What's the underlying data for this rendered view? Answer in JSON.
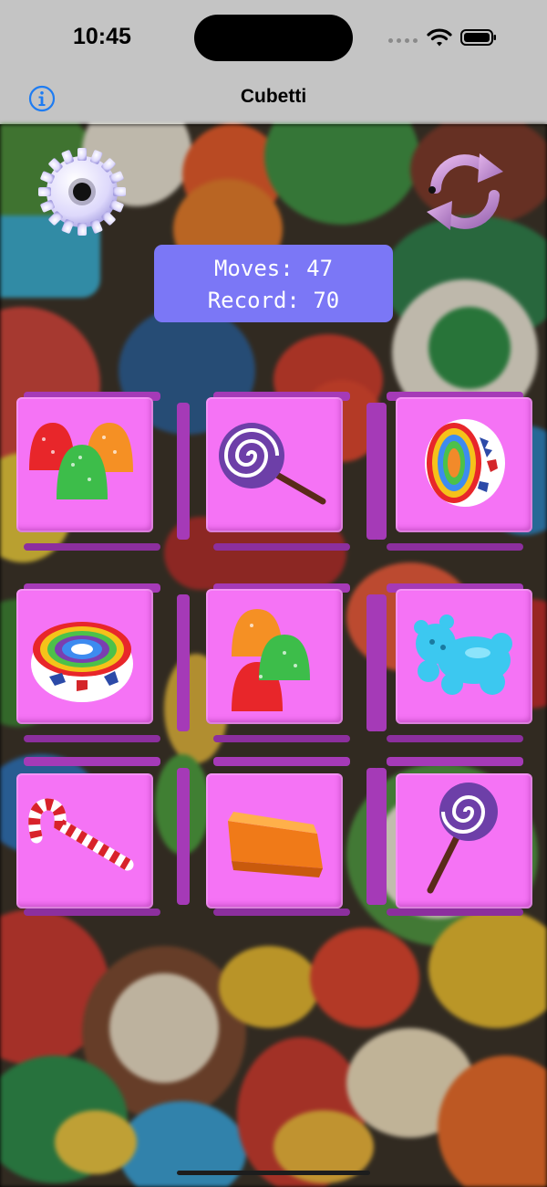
{
  "status": {
    "time": "10:45"
  },
  "nav": {
    "title": "Cubetti"
  },
  "game": {
    "moves_label": "Moves:",
    "moves": "47",
    "record_label": "Record:",
    "record": "70"
  },
  "grid": [
    [
      "gumdrops",
      "lollipop",
      "swirl-candy-slice"
    ],
    [
      "swirl-candy-slice",
      "gumdrops",
      "gummy-bear"
    ],
    [
      "candy-cane",
      "caramel-block",
      "lollipop"
    ]
  ],
  "colors": {
    "bars": "#c4c4c4",
    "score_panel": "#7b77f6",
    "cube_face": "#f573f5",
    "cube_side": "#a53ab7",
    "info_accent": "#1e7cf2"
  }
}
